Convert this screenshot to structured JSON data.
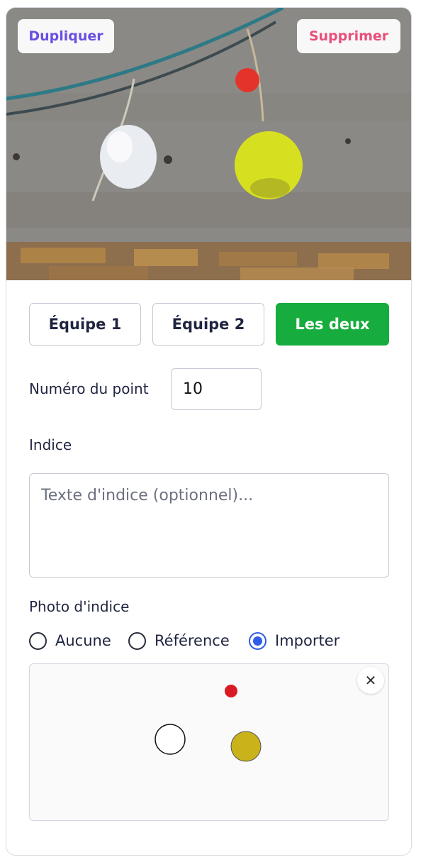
{
  "header": {
    "duplicate_label": "Dupliquer",
    "delete_label": "Supprimer"
  },
  "teams": {
    "team1_label": "Équipe 1",
    "team2_label": "Équipe 2",
    "both_label": "Les deux",
    "selected": "Les deux"
  },
  "point": {
    "label": "Numéro du point",
    "value": "10"
  },
  "hint": {
    "label": "Indice",
    "placeholder": "Texte d'indice (optionnel)..."
  },
  "hint_photo": {
    "label": "Photo d'indice",
    "options": [
      "Aucune",
      "Référence",
      "Importer"
    ],
    "selected": "Importer",
    "close_glyph": "✕"
  },
  "colors": {
    "accent_green": "#17ad3e",
    "duplicate_purple": "#6b4fe0",
    "delete_pink": "#e8507a",
    "radio_blue": "#2f5ee6"
  }
}
